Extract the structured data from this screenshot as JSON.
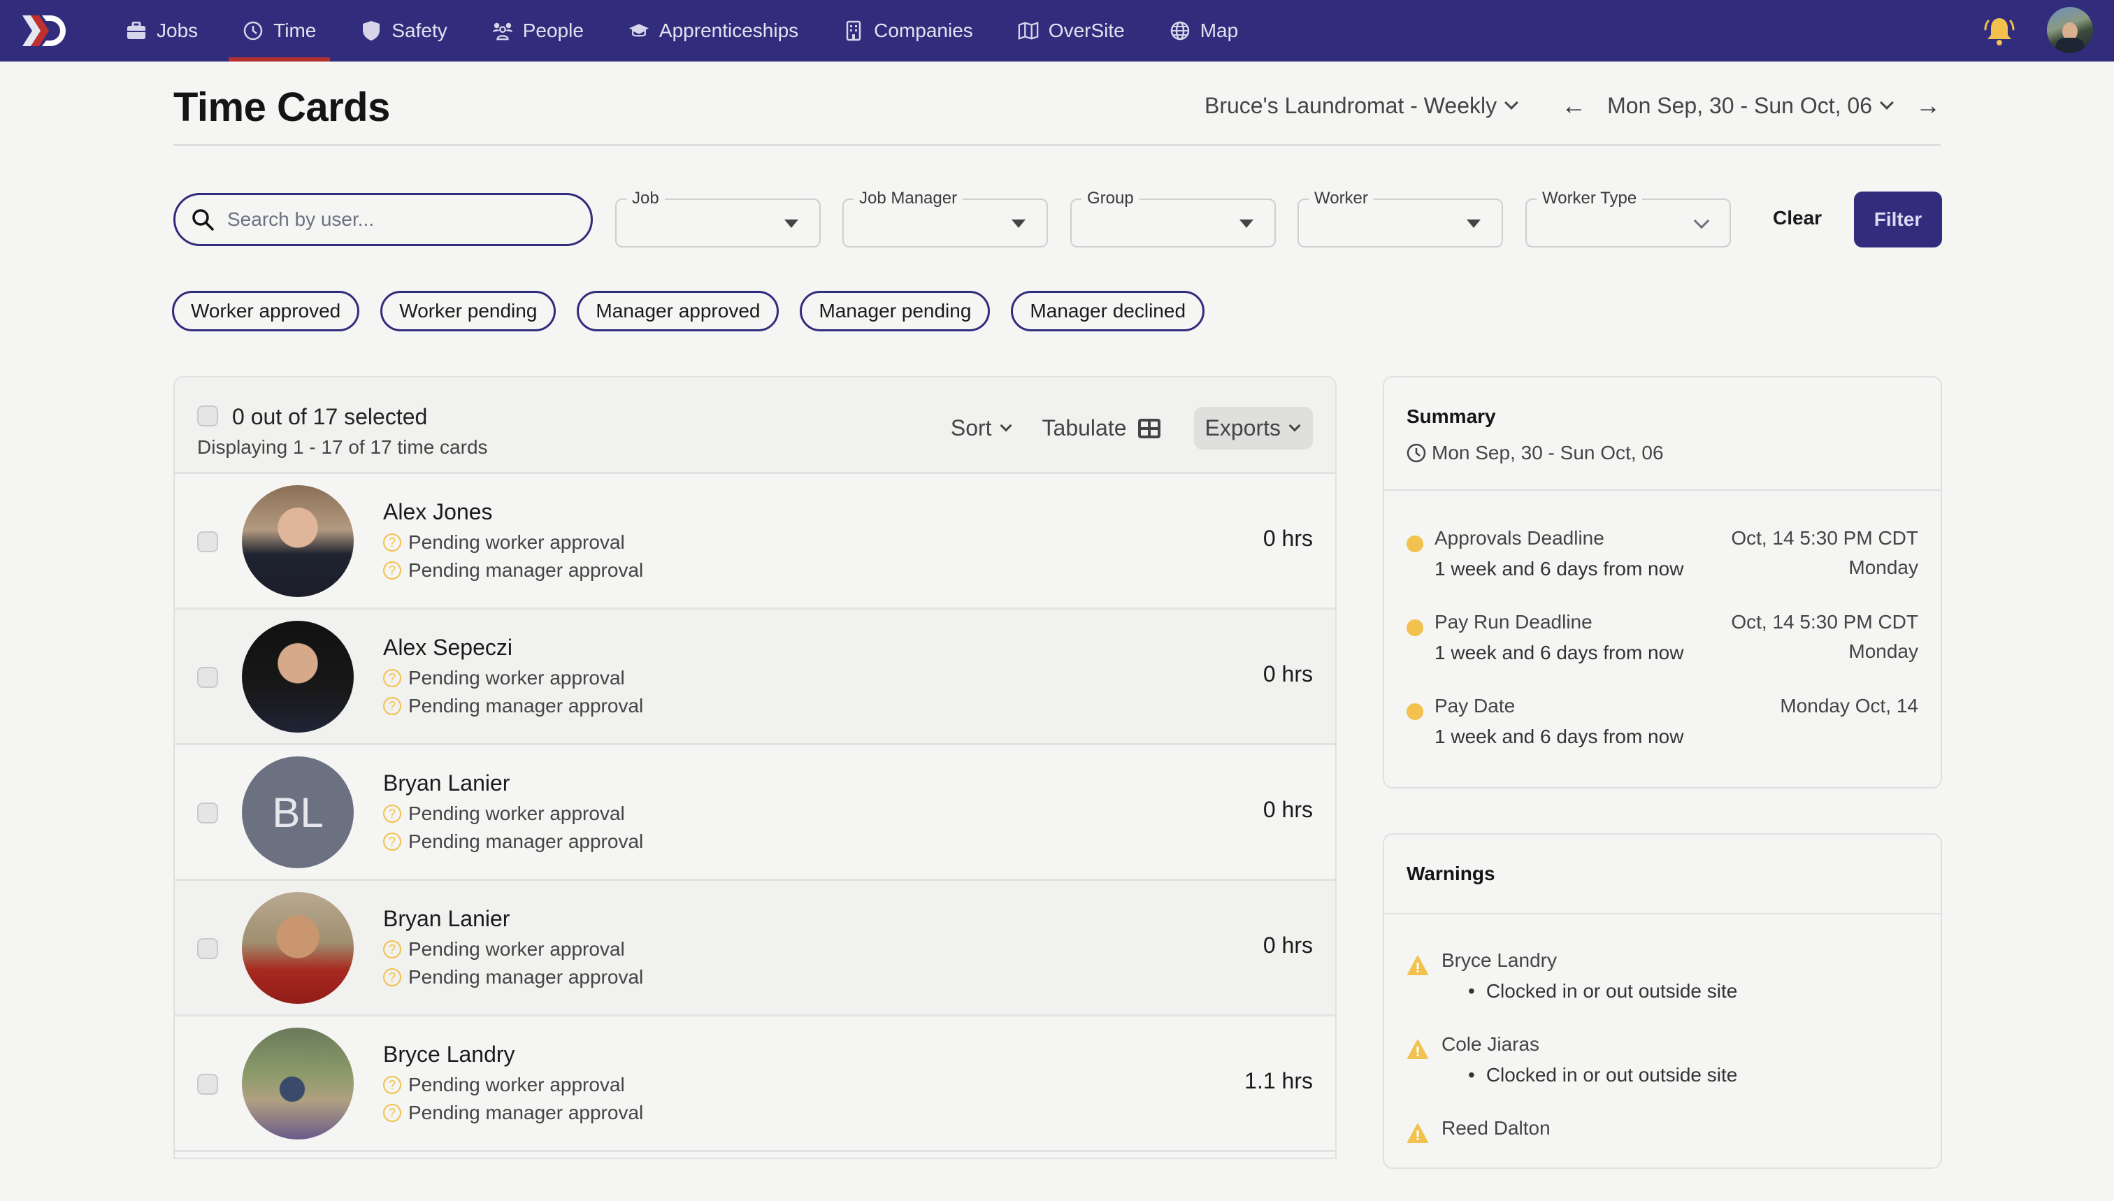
{
  "nav": {
    "items": [
      {
        "label": "Jobs",
        "icon": "briefcase-icon",
        "active": false
      },
      {
        "label": "Time",
        "icon": "clock-icon",
        "active": true
      },
      {
        "label": "Safety",
        "icon": "shield-icon",
        "active": false
      },
      {
        "label": "People",
        "icon": "users-icon",
        "active": false
      },
      {
        "label": "Apprenticeships",
        "icon": "graduation-cap-icon",
        "active": false
      },
      {
        "label": "Companies",
        "icon": "building-icon",
        "active": false
      },
      {
        "label": "OverSite",
        "icon": "map-icon",
        "active": false
      },
      {
        "label": "Map",
        "icon": "globe-icon",
        "active": false
      }
    ],
    "colors": {
      "bar": "#312c7c",
      "active_underline": "#b3302f",
      "bell": "#f2c14e"
    }
  },
  "header": {
    "title": "Time Cards",
    "pay_schedule": "Bruce's Laundromat - Weekly",
    "date_range": "Mon Sep, 30 - Sun Oct, 06"
  },
  "filters": {
    "search_placeholder": "Search by user...",
    "search_value": "",
    "selects": [
      {
        "label": "Job",
        "value": ""
      },
      {
        "label": "Job Manager",
        "value": ""
      },
      {
        "label": "Group",
        "value": ""
      },
      {
        "label": "Worker",
        "value": ""
      },
      {
        "label": "Worker Type",
        "value": ""
      }
    ],
    "clear_label": "Clear",
    "filter_label": "Filter"
  },
  "chips": [
    "Worker approved",
    "Worker pending",
    "Manager approved",
    "Manager pending",
    "Manager declined"
  ],
  "list": {
    "selected_text": "0 out of 17 selected",
    "display_text": "Displaying 1 - 17 of 17 time cards",
    "sort_label": "Sort",
    "tabulate_label": "Tabulate",
    "exports_label": "Exports",
    "rows": [
      {
        "name": "Alex Jones",
        "avatar": "photo",
        "initials": "",
        "worker_status": "Pending worker approval",
        "manager_status": "Pending manager approval",
        "hours": "0 hrs"
      },
      {
        "name": "Alex Sepeczi",
        "avatar": "photo",
        "initials": "",
        "worker_status": "Pending worker approval",
        "manager_status": "Pending manager approval",
        "hours": "0 hrs"
      },
      {
        "name": "Bryan Lanier",
        "avatar": "initials",
        "initials": "BL",
        "worker_status": "Pending worker approval",
        "manager_status": "Pending manager approval",
        "hours": "0 hrs"
      },
      {
        "name": "Bryan Lanier",
        "avatar": "photo",
        "initials": "",
        "worker_status": "Pending worker approval",
        "manager_status": "Pending manager approval",
        "hours": "0 hrs"
      },
      {
        "name": "Bryce Landry",
        "avatar": "photo",
        "initials": "",
        "worker_status": "Pending worker approval",
        "manager_status": "Pending manager approval",
        "hours": "1.1 hrs"
      }
    ]
  },
  "summary": {
    "title": "Summary",
    "range": "Mon Sep, 30 - Sun Oct, 06",
    "deadlines": [
      {
        "title": "Approvals Deadline",
        "relative": "1 week and 6 days from now",
        "date": "Oct, 14 5:30 PM CDT",
        "day": "Monday"
      },
      {
        "title": "Pay Run Deadline",
        "relative": "1 week and 6 days from now",
        "date": "Oct, 14 5:30 PM CDT",
        "day": "Monday"
      },
      {
        "title": "Pay Date",
        "relative": "1 week and 6 days from now",
        "date": "Monday Oct, 14",
        "day": ""
      }
    ]
  },
  "warnings": {
    "title": "Warnings",
    "items": [
      {
        "name": "Bryce Landry",
        "detail": "Clocked in or out outside site"
      },
      {
        "name": "Cole Jiaras",
        "detail": "Clocked in or out outside site"
      },
      {
        "name": "Reed Dalton",
        "detail": ""
      }
    ]
  }
}
